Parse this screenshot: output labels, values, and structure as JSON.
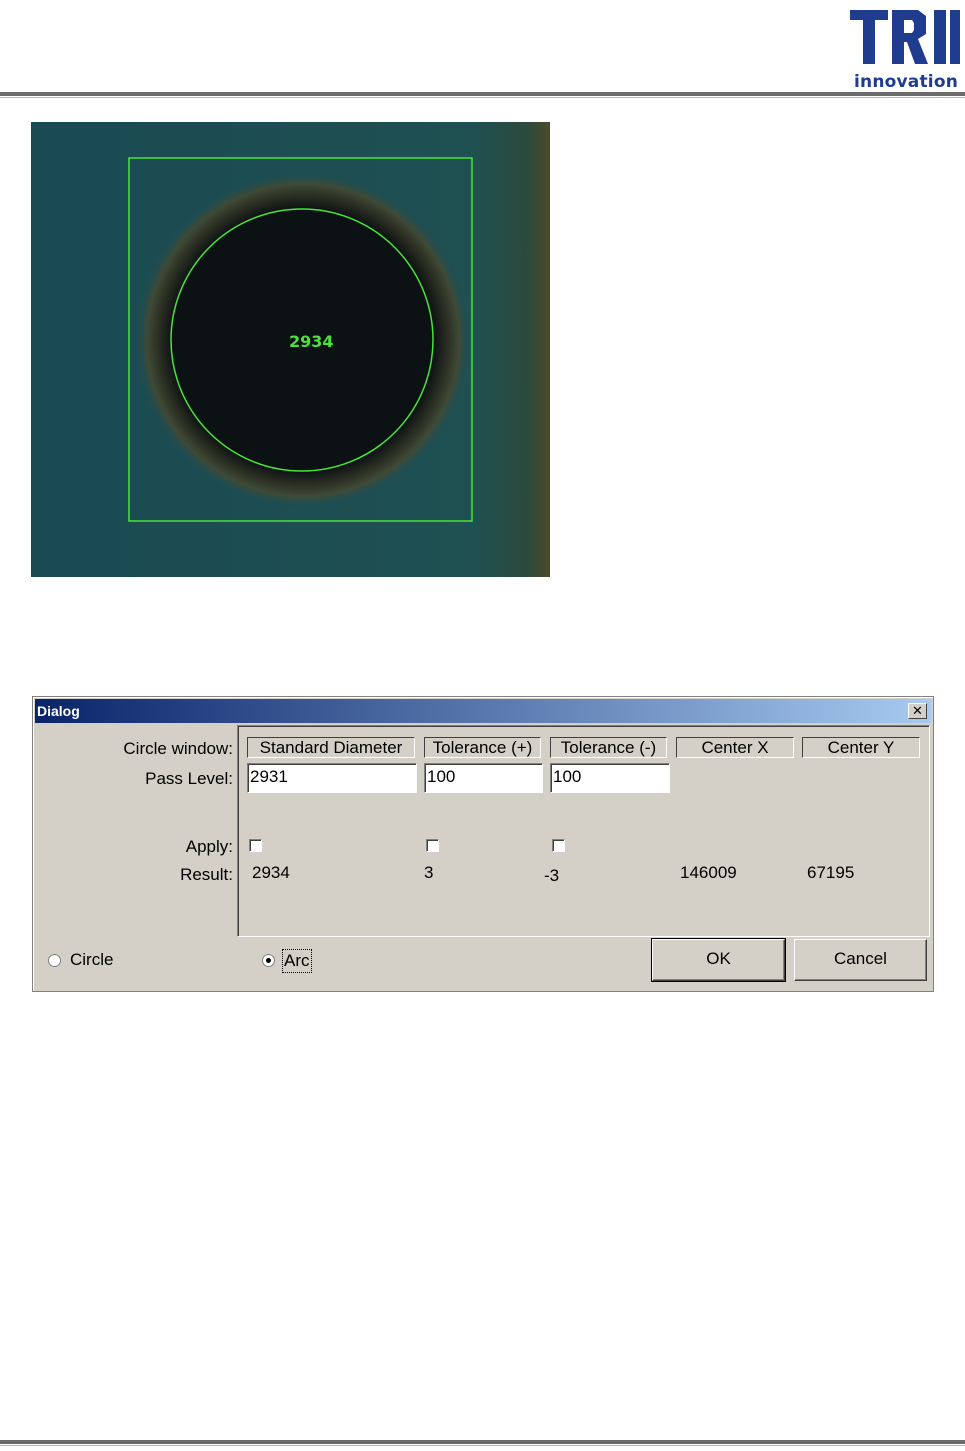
{
  "header": {
    "logo_main": "TRI",
    "logo_sub": "innovation",
    "brand_color": "#1f3c8f"
  },
  "inspection_image": {
    "measured_value": "2934",
    "overlay_color": "#49e43a"
  },
  "dialog": {
    "title": "Dialog",
    "close_label": "✕",
    "labels": {
      "circle_window": "Circle window:",
      "pass_level": "Pass Level:",
      "apply": "Apply:",
      "result": "Result:"
    },
    "columns": [
      {
        "header": "Standard Diameter",
        "pass_level": "2931",
        "apply": false,
        "result": "2934"
      },
      {
        "header": "Tolerance (+)",
        "pass_level": "100",
        "apply": false,
        "result": "3"
      },
      {
        "header": "Tolerance (-)",
        "pass_level": "100",
        "apply": false,
        "result": "-3"
      },
      {
        "header": "Center X",
        "result": "146009"
      },
      {
        "header": "Center Y",
        "result": "67195"
      }
    ],
    "mode_options": [
      {
        "label": "Circle",
        "selected": false
      },
      {
        "label": "Arc",
        "selected": true
      }
    ],
    "ok_label": "OK",
    "cancel_label": "Cancel"
  }
}
